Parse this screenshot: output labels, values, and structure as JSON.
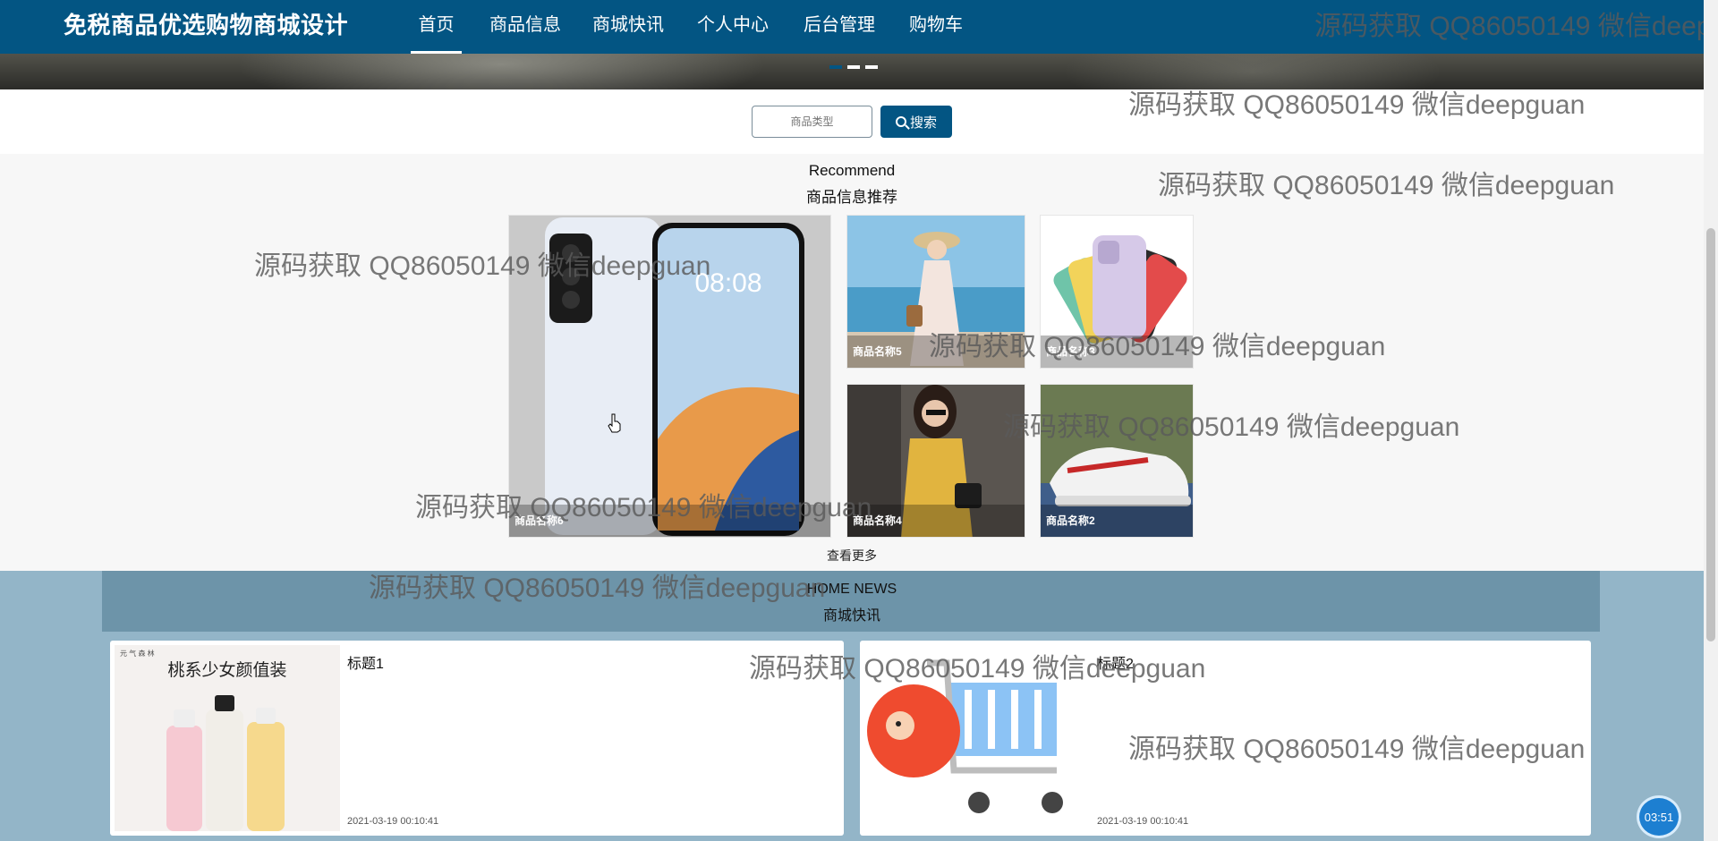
{
  "header": {
    "site_title": "免税商品优选购物商城设计",
    "nav": [
      {
        "label": "首页",
        "active": true
      },
      {
        "label": "商品信息"
      },
      {
        "label": "商城快讯"
      },
      {
        "label": "个人中心"
      },
      {
        "label": "后台管理"
      },
      {
        "label": "购物车"
      }
    ]
  },
  "search": {
    "placeholder": "商品类型",
    "button_label": "搜索"
  },
  "recommend": {
    "title_en": "Recommend",
    "title_zh": "商品信息推荐",
    "products": [
      {
        "name": "商品名称6",
        "image": "phone-image"
      },
      {
        "name": "商品名称5",
        "image": "dress-image"
      },
      {
        "name": "商品名称3",
        "image": "iphone-image"
      },
      {
        "name": "商品名称4",
        "image": "sweater-image"
      },
      {
        "name": "商品名称2",
        "image": "sneaker-image"
      }
    ],
    "more_label": "查看更多"
  },
  "news": {
    "title_en": "HOME NEWS",
    "title_zh": "商城快讯",
    "items": [
      {
        "title": "标题1",
        "date": "2021-03-19 00:10:41",
        "image": "drinks-image",
        "image_caption": "桃系少女颜值装",
        "image_tag": "元 气 森 林"
      },
      {
        "title": "标题2",
        "date": "2021-03-19 00:10:41",
        "image": "shopping-cart-image"
      }
    ]
  },
  "phone_screen_time": "08:08",
  "watermark_text": "源码获取 QQ86050149 微信deepguan",
  "clock_text": "03:51",
  "colors": {
    "nav_bg": "#035583",
    "news_bg": "#93b5c8",
    "news_header_bg": "#6d94a9",
    "recommend_bg": "#f7f7f7"
  }
}
